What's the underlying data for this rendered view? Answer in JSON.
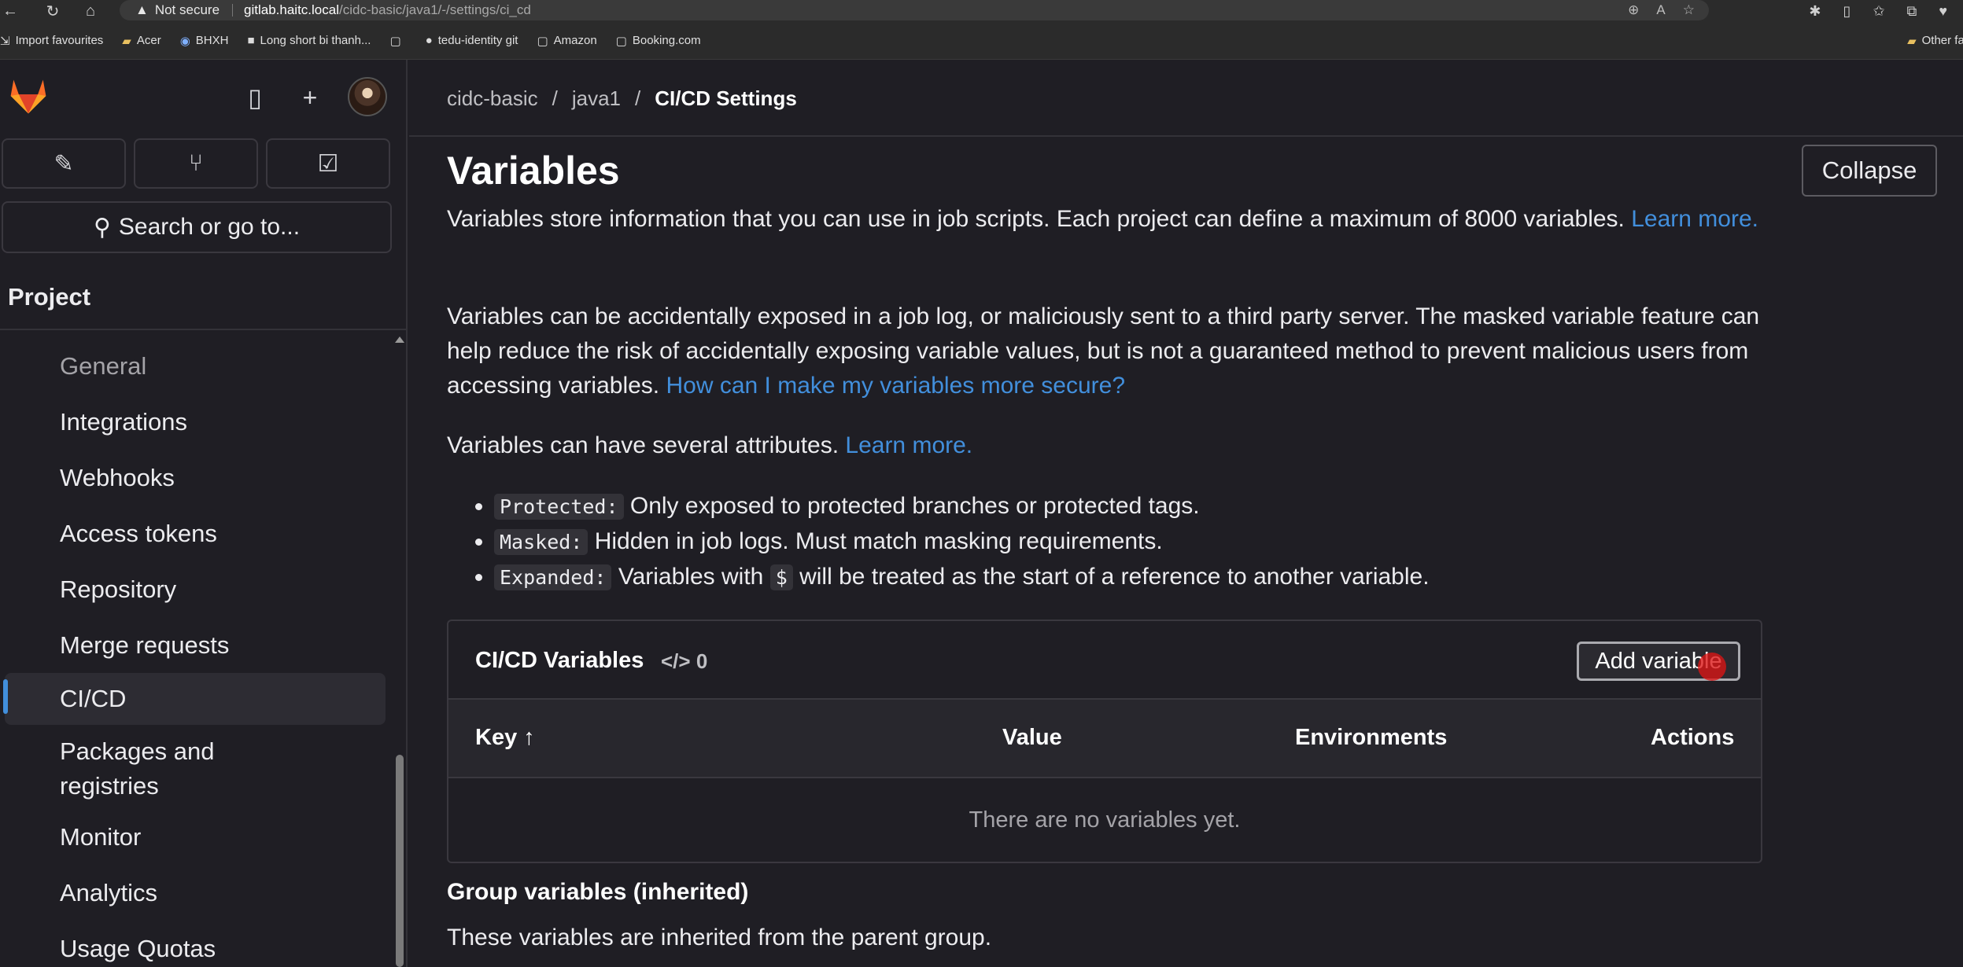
{
  "browser": {
    "security": "Not secure",
    "url_host": "gitlab.haitc.local",
    "url_path": "/cidc-basic/java1/-/settings/ci_cd",
    "bookmarks": [
      {
        "label": "Import favourites"
      },
      {
        "label": "Acer"
      },
      {
        "label": "BHXH"
      },
      {
        "label": "Long short bi thanh..."
      },
      {
        "label": ""
      },
      {
        "label": "tedu-identity git"
      },
      {
        "label": "Amazon"
      },
      {
        "label": "Booking.com"
      }
    ],
    "other_favourites": "Other favou"
  },
  "sidebar": {
    "search_label": "Search or go to...",
    "section_title": "Project",
    "items": [
      {
        "label": "General"
      },
      {
        "label": "Integrations"
      },
      {
        "label": "Webhooks"
      },
      {
        "label": "Access tokens"
      },
      {
        "label": "Repository"
      },
      {
        "label": "Merge requests"
      },
      {
        "label": "CI/CD"
      },
      {
        "label": "Packages and"
      },
      {
        "label": "registries"
      },
      {
        "label": "Monitor"
      },
      {
        "label": "Analytics"
      },
      {
        "label": "Usage Quotas"
      }
    ]
  },
  "breadcrumb": {
    "items": [
      "cidc-basic",
      "java1",
      "CI/CD Settings"
    ],
    "separator": "/"
  },
  "variables": {
    "title": "Variables",
    "collapse_label": "Collapse",
    "intro": "Variables store information that you can use in job scripts. Each project can define a maximum of 8000 variables.",
    "learn_more_1": "Learn more.",
    "security_note": "Variables can be accidentally exposed in a job log, or maliciously sent to a third party server. The masked variable feature can help reduce the risk of accidentally exposing variable values, but is not a guaranteed method to prevent malicious users from accessing variables.",
    "security_link": "How can I make my variables more secure?",
    "attributes_intro": "Variables can have several attributes.",
    "learn_more_2": "Learn more.",
    "attributes": [
      {
        "code": "Protected:",
        "text": "Only exposed to protected branches or protected tags."
      },
      {
        "code": "Masked:",
        "text": "Hidden in job logs. Must match masking requirements."
      },
      {
        "code": "Expanded:",
        "text_before": "Variables with",
        "inline_code": "$",
        "text_after": "will be treated as the start of a reference to another variable."
      }
    ]
  },
  "table": {
    "title": "CI/CD Variables",
    "count_icon": "code-icon",
    "count": "0",
    "add_label": "Add variable",
    "columns": [
      "Key",
      "Value",
      "Environments",
      "Actions"
    ],
    "sort_indicator": "↑",
    "empty_text": "There are no variables yet."
  },
  "group": {
    "title": "Group variables (inherited)",
    "description": "These variables are inherited from the parent group."
  },
  "colors": {
    "accent": "#428fdc",
    "background": "#1f1e24",
    "border": "#3a383f"
  }
}
